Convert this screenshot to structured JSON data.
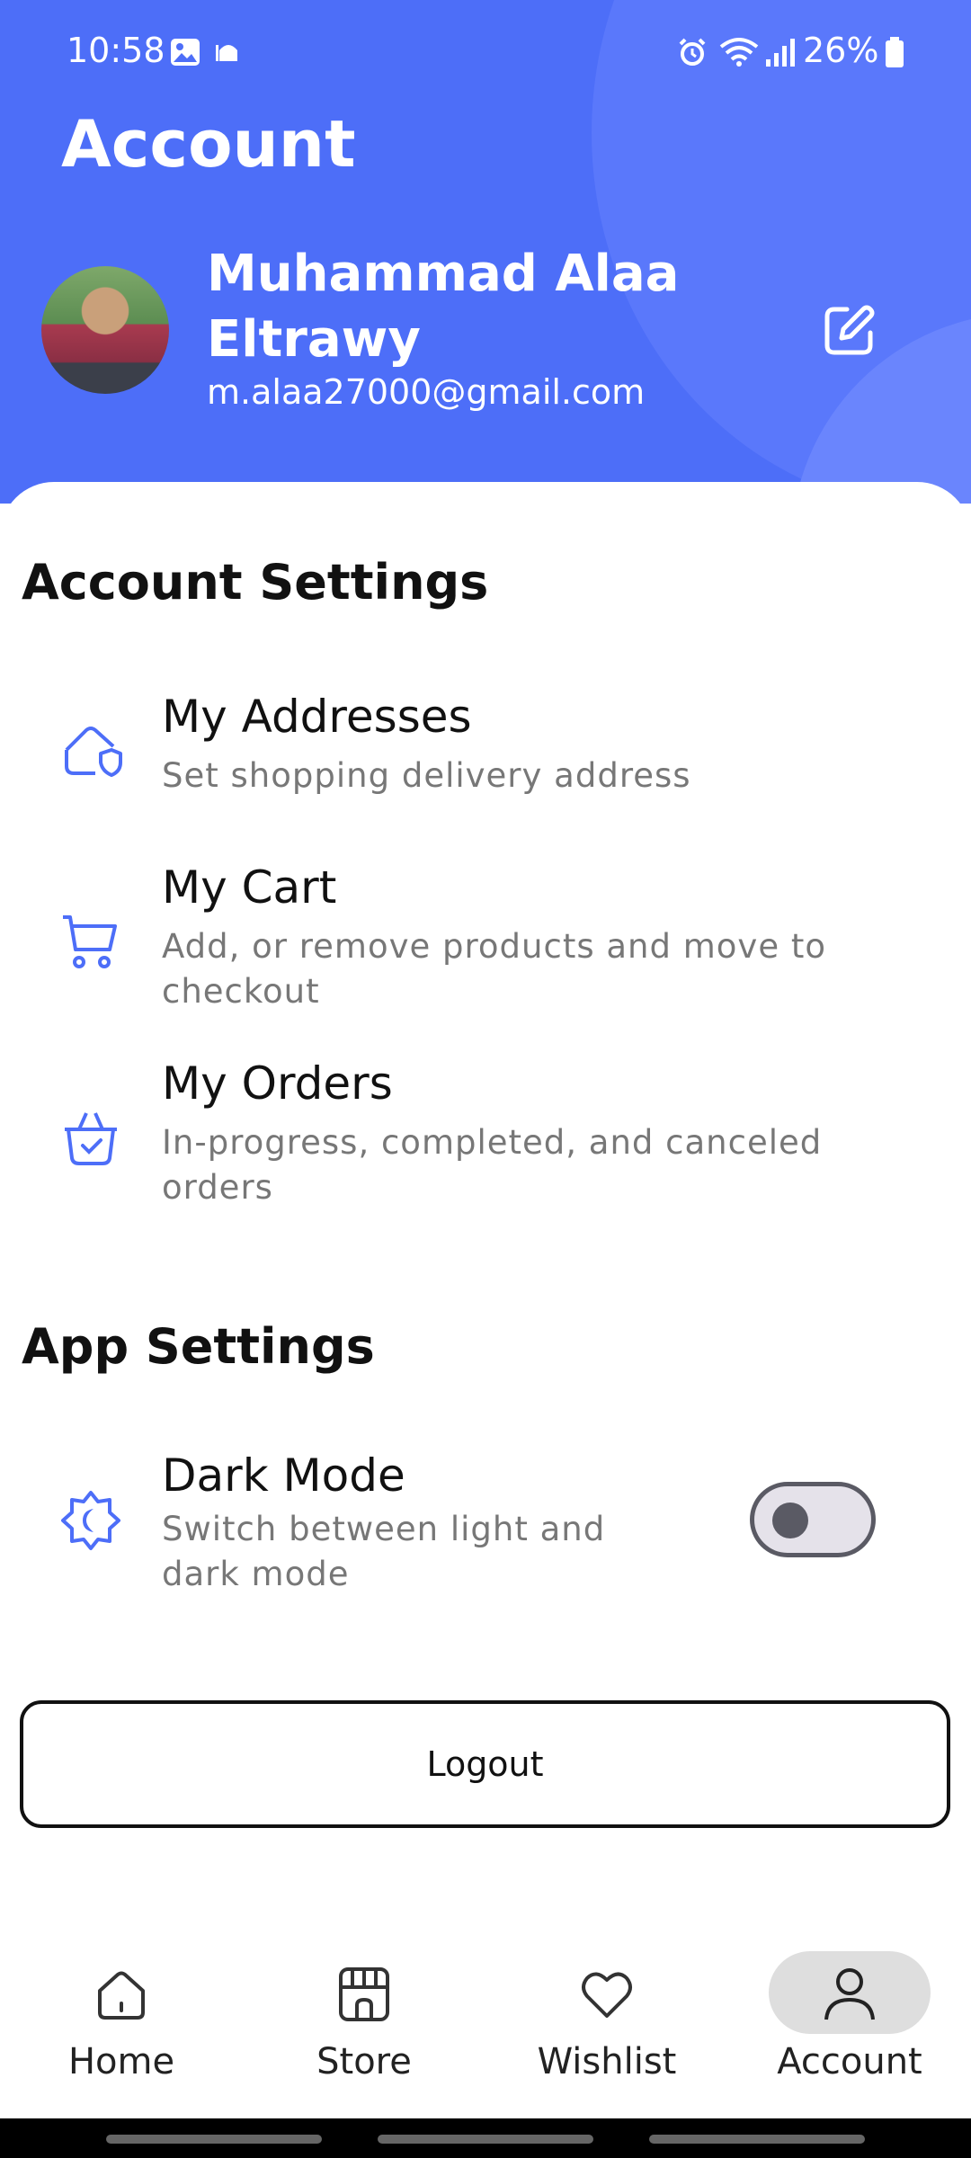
{
  "status_bar": {
    "time": "10:58",
    "battery": "26%"
  },
  "header": {
    "title": "Account",
    "name": "Muhammad Alaa Eltrawy",
    "email": "m.alaa27000@gmail.com"
  },
  "account_settings": {
    "title": "Account Settings",
    "items": [
      {
        "title": "My Addresses",
        "subtitle": "Set shopping delivery address",
        "icon": "home-shield-icon"
      },
      {
        "title": "My Cart",
        "subtitle": "Add, or remove products and move to checkout",
        "icon": "cart-icon"
      },
      {
        "title": "My Orders",
        "subtitle": "In-progress, completed, and canceled orders",
        "icon": "basket-check-icon"
      }
    ]
  },
  "app_settings": {
    "title": "App Settings",
    "items": [
      {
        "title": "Dark Mode",
        "subtitle": "Switch between light and dark mode",
        "icon": "sun-moon-icon",
        "toggle_on": false
      }
    ]
  },
  "logout_label": "Logout",
  "nav": {
    "items": [
      {
        "label": "Home",
        "icon": "home-icon",
        "active": false
      },
      {
        "label": "Store",
        "icon": "store-icon",
        "active": false
      },
      {
        "label": "Wishlist",
        "icon": "heart-icon",
        "active": false
      },
      {
        "label": "Account",
        "icon": "user-icon",
        "active": true
      }
    ]
  },
  "colors": {
    "primary": "#4d6ef8",
    "muted_text": "#777777"
  }
}
